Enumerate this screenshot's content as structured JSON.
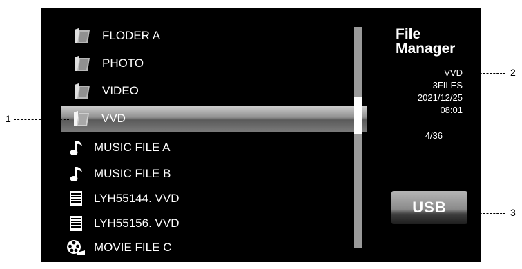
{
  "file_list": [
    {
      "name": "FLODER A",
      "type": "folder",
      "icon": "folder-icon"
    },
    {
      "name": "PHOTO",
      "type": "folder",
      "icon": "folder-icon"
    },
    {
      "name": "VIDEO",
      "type": "folder",
      "icon": "folder-icon"
    },
    {
      "name": "VVD",
      "type": "folder",
      "icon": "folder-icon",
      "selected": true
    },
    {
      "name": "MUSIC FILE A",
      "type": "music",
      "icon": "music-note-icon"
    },
    {
      "name": "MUSIC FILE B",
      "type": "music",
      "icon": "music-note-icon"
    },
    {
      "name": "LYH55144. VVD",
      "type": "document",
      "icon": "document-icon"
    },
    {
      "name": "LYH55156. VVD",
      "type": "document",
      "icon": "document-icon"
    },
    {
      "name": "MOVIE FILE C",
      "type": "movie",
      "icon": "film-reel-icon"
    }
  ],
  "panel": {
    "title_line1": "File",
    "title_line2": "Manager",
    "selected_name": "VVD",
    "file_count": "3FILES",
    "date": "2021/12/25",
    "time": "08:01",
    "position": "4/36",
    "usb_label": "USB"
  },
  "callouts": {
    "one": "1",
    "two": "2",
    "three": "3"
  },
  "colors": {
    "screen_bg": "#000000",
    "text": "#ffffff",
    "selection": "#8c8c8c",
    "scrollbar": "#9a9a9a"
  }
}
